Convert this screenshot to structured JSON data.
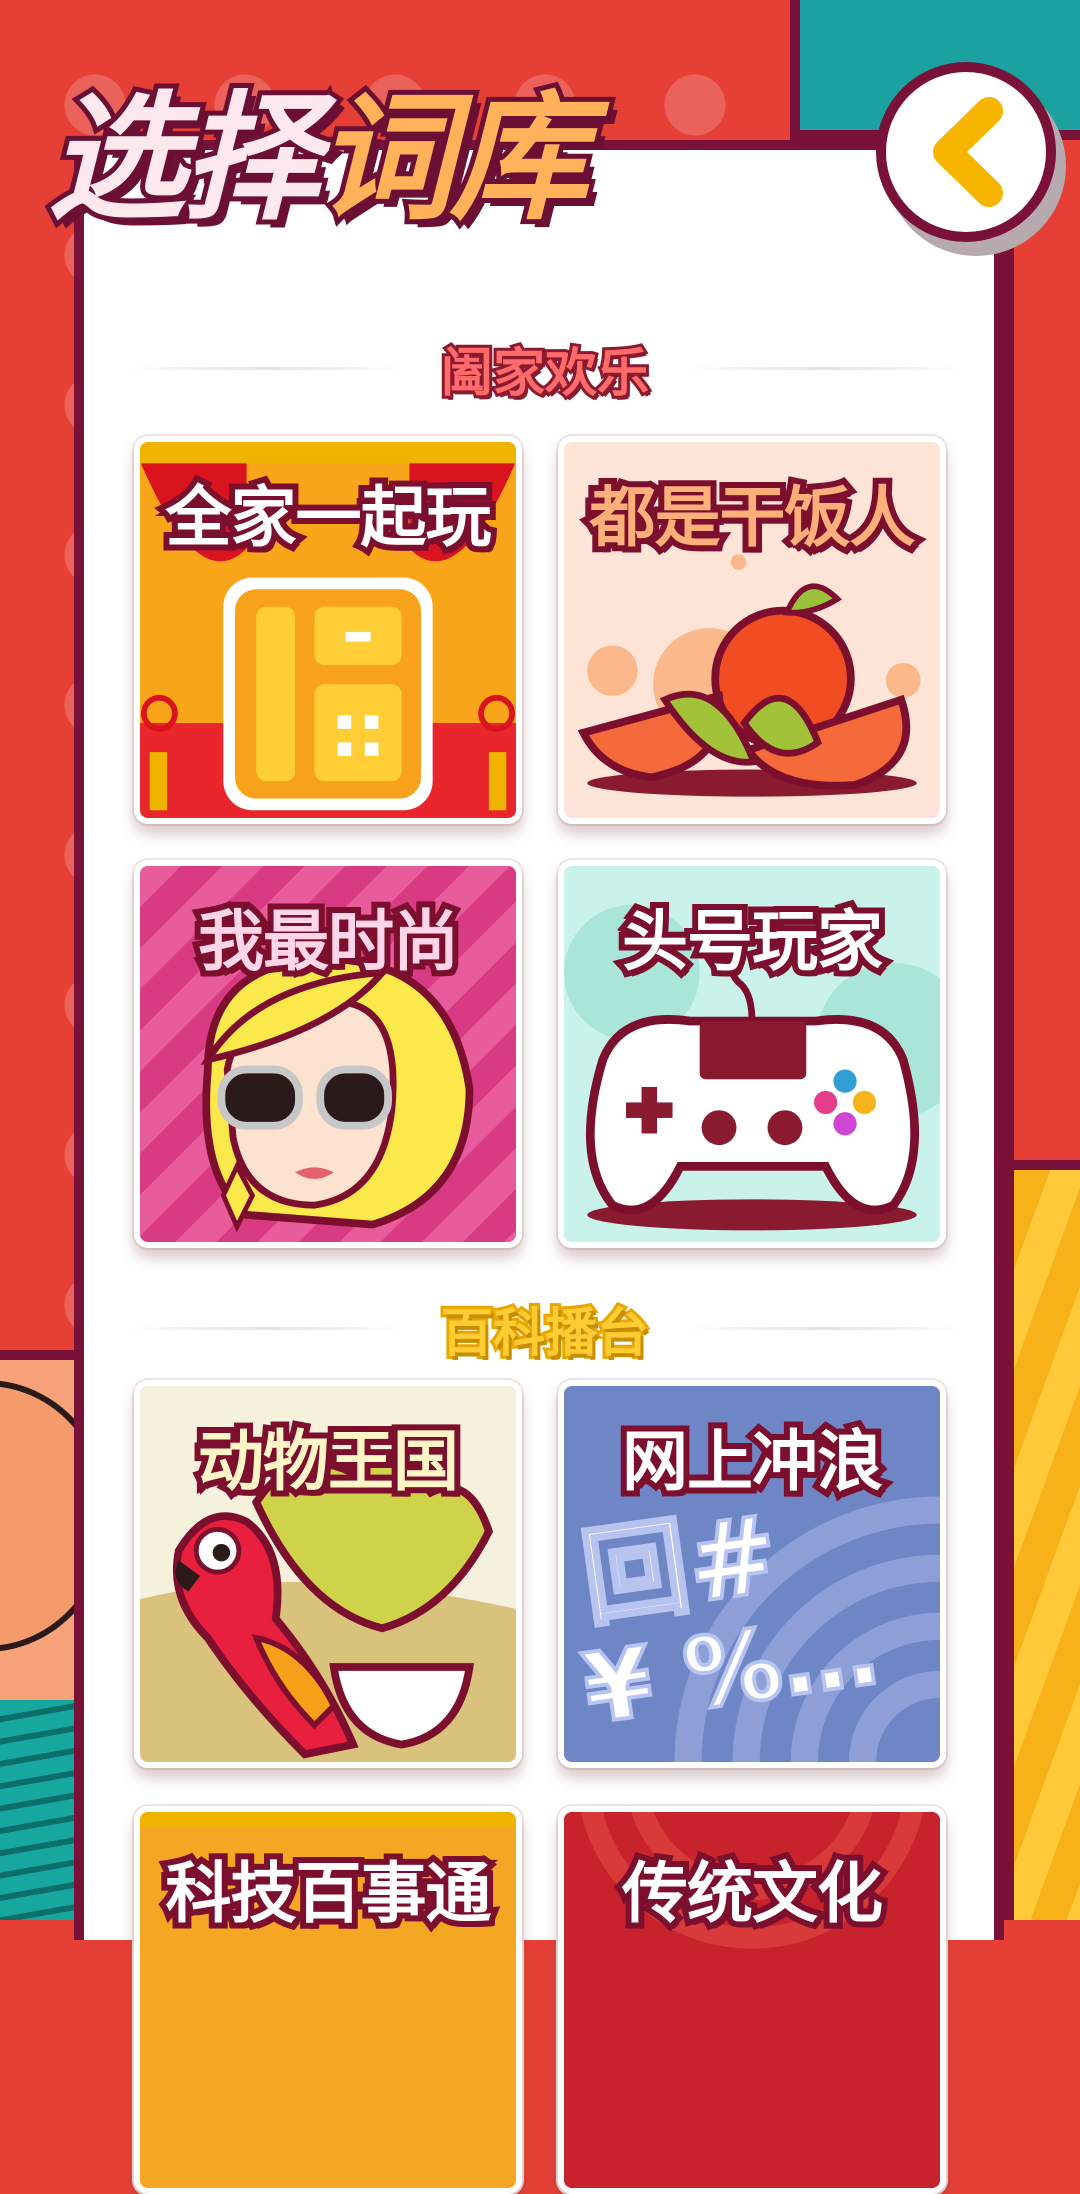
{
  "header": {
    "title_part1": "选择",
    "title_part2": "词库",
    "back_icon": "chevron-left-icon"
  },
  "sections": [
    {
      "title": "阖家欢乐",
      "title_color": "#ff5a5a",
      "cards": [
        {
          "label": "全家一起玩",
          "label_color": "#ffffff",
          "bg": "#e8262c"
        },
        {
          "label": "都是干饭人",
          "label_color": "#ffb07a",
          "bg": "#fde4d6"
        },
        {
          "label": "我最时尚",
          "label_color": "#ffd6e8",
          "bg": "#e0428a"
        },
        {
          "label": "头号玩家",
          "label_color": "#ffffff",
          "bg": "#c9f3ea"
        }
      ]
    },
    {
      "title": "百科播台",
      "title_color": "#ffcc33",
      "cards": [
        {
          "label": "动物王国",
          "label_color": "#fff6c8",
          "bg": "#f6f1dc"
        },
        {
          "label": "网上冲浪",
          "label_color": "#ffffff",
          "bg": "#6f86c6"
        },
        {
          "label": "科技百事通",
          "label_color": "#ffffff",
          "bg": "#f5a623"
        },
        {
          "label": "传统文化",
          "label_color": "#ffffff",
          "bg": "#c8232c"
        }
      ]
    }
  ],
  "colors": {
    "accent": "#7a1138",
    "background": "#e53f36",
    "teal": "#1aa1a0",
    "back_icon": "#f7b500"
  }
}
